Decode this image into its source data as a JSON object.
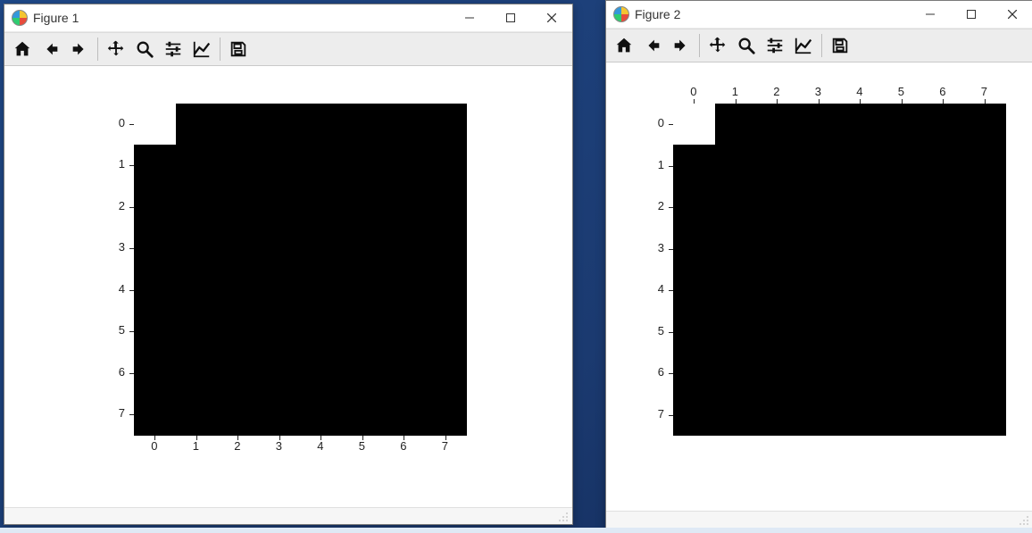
{
  "windows": [
    {
      "title": "Figure 1",
      "xaxis_pos": "bottom"
    },
    {
      "title": "Figure 2",
      "xaxis_pos": "top"
    }
  ],
  "toolbar": {
    "home": "Home",
    "back": "Back",
    "forward": "Forward",
    "pan": "Pan",
    "zoom": "Zoom",
    "subplots": "Configure subplots",
    "edit": "Edit axes",
    "save": "Save"
  },
  "winctrl": {
    "min": "Minimize",
    "max": "Maximize",
    "close": "Close"
  },
  "ticks": [
    "0",
    "1",
    "2",
    "3",
    "4",
    "5",
    "6",
    "7"
  ],
  "chart_data": [
    {
      "type": "heatmap",
      "title": "",
      "xlabel": "",
      "ylabel": "",
      "x": [
        0,
        1,
        2,
        3,
        4,
        5,
        6,
        7
      ],
      "y": [
        0,
        1,
        2,
        3,
        4,
        5,
        6,
        7
      ],
      "xlim": [
        -0.5,
        7.5
      ],
      "ylim": [
        7.5,
        -0.5
      ],
      "xaxis_position": "bottom",
      "values": [
        [
          1,
          0,
          0,
          0,
          0,
          0,
          0,
          0
        ],
        [
          0,
          0,
          0,
          0,
          0,
          0,
          0,
          0
        ],
        [
          0,
          0,
          0,
          0,
          0,
          0,
          0,
          0
        ],
        [
          0,
          0,
          0,
          0,
          0,
          0,
          0,
          0
        ],
        [
          0,
          0,
          0,
          0,
          0,
          0,
          0,
          0
        ],
        [
          0,
          0,
          0,
          0,
          0,
          0,
          0,
          0
        ],
        [
          0,
          0,
          0,
          0,
          0,
          0,
          0,
          0
        ],
        [
          0,
          0,
          0,
          0,
          0,
          0,
          0,
          0
        ]
      ],
      "colormap": {
        "0": "#000000",
        "1": "#ffffff"
      }
    },
    {
      "type": "heatmap",
      "title": "",
      "xlabel": "",
      "ylabel": "",
      "x": [
        0,
        1,
        2,
        3,
        4,
        5,
        6,
        7
      ],
      "y": [
        0,
        1,
        2,
        3,
        4,
        5,
        6,
        7
      ],
      "xlim": [
        -0.5,
        7.5
      ],
      "ylim": [
        7.5,
        -0.5
      ],
      "xaxis_position": "top",
      "values": [
        [
          1,
          0,
          0,
          0,
          0,
          0,
          0,
          0
        ],
        [
          0,
          0,
          0,
          0,
          0,
          0,
          0,
          0
        ],
        [
          0,
          0,
          0,
          0,
          0,
          0,
          0,
          0
        ],
        [
          0,
          0,
          0,
          0,
          0,
          0,
          0,
          0
        ],
        [
          0,
          0,
          0,
          0,
          0,
          0,
          0,
          0
        ],
        [
          0,
          0,
          0,
          0,
          0,
          0,
          0,
          0
        ],
        [
          0,
          0,
          0,
          0,
          0,
          0,
          0,
          0
        ],
        [
          0,
          0,
          0,
          0,
          0,
          0,
          0,
          0
        ]
      ],
      "colormap": {
        "0": "#000000",
        "1": "#ffffff"
      }
    }
  ]
}
